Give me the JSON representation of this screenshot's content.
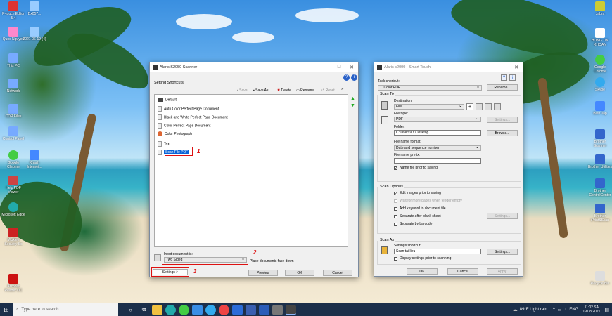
{
  "desktop": {
    "icons_left": [
      {
        "label": "P-touch Editor 5.4",
        "color": "#d33"
      },
      {
        "label": "Dx057...",
        "color": "#9cf"
      },
      {
        "label": "Quoc Nguyen",
        "color": "#f8c"
      },
      {
        "label": "2021-06-19 (4)",
        "color": "#9cf"
      },
      {
        "label": "This PC",
        "color": "#7af"
      },
      {
        "label": "Network",
        "color": "#7af"
      },
      {
        "label": "CDR Files",
        "color": "#7af"
      },
      {
        "label": "Control Panel",
        "color": "#7af"
      },
      {
        "label": "Google Chrome",
        "color": "#4c4"
      },
      {
        "label": "Khach Internet...",
        "color": "#48f"
      },
      {
        "label": "Help PDF Viewer",
        "color": "#c44"
      },
      {
        "label": "Microsoft Edge",
        "color": "#2aa"
      },
      {
        "label": "McAfee Security Sc",
        "color": "#c22"
      },
      {
        "label": "Acrobat Reader DC",
        "color": "#c11"
      }
    ],
    "icons_right": [
      {
        "label": "Jabra",
        "color": "#cc3"
      },
      {
        "label": "HONG TIN KHOAN",
        "color": "#fff"
      },
      {
        "label": "Google Chrome",
        "color": "#4c4"
      },
      {
        "label": "Skype",
        "color": "#3ae"
      },
      {
        "label": "Bien Tap",
        "color": "#48f"
      },
      {
        "label": "Brother Scanner",
        "color": "#36c"
      },
      {
        "label": "Brother Utilities",
        "color": "#36c"
      },
      {
        "label": "Brother ControlCenter",
        "color": "#36c"
      },
      {
        "label": "Brother iPrint&Scan",
        "color": "#36c"
      },
      {
        "label": "Recycle Bin",
        "color": "#ddd"
      }
    ]
  },
  "scanner_window": {
    "title": "Alaris S2050 Scanner",
    "section": "Setting Shortcuts:",
    "toolbar": {
      "save": "Save",
      "save_as": "Save As...",
      "delete": "Delete",
      "rename": "Rename...",
      "reset": "Reset"
    },
    "shortcuts": [
      "Default",
      "Auto Color Perfect Page Document",
      "Black and White Perfect Page Document",
      "Color Perfect Page Document",
      "Color Photograph",
      "Text",
      "Scan File PDF"
    ],
    "input_label": "Input document is:",
    "input_value": "Two Sided",
    "place_text": "Place documents face down",
    "buttons": {
      "settings": "Settings >",
      "preview": "Preview",
      "ok": "OK",
      "cancel": "Cancel"
    },
    "annotations": [
      "1",
      "2",
      "3"
    ]
  },
  "smart_window": {
    "title": "Alaris s2000 - Smart Touch",
    "task_label": "Task shortcut:",
    "task_value": "1. Color PDF",
    "rename": "Rename...",
    "scan_to": "Scan To",
    "destination_label": "Destination:",
    "destination_value": "File",
    "file_type_label": "File type:",
    "file_type_value": "PDF",
    "settings": "Settings...",
    "folder_label": "Folder:",
    "folder_value": "C:\\Users\\LY\\Desktop",
    "browse": "Browse...",
    "name_format_label": "File name format:",
    "name_format_value": "Date and sequence number",
    "prefix_label": "File name prefix:",
    "prefix_value": "",
    "name_prior": "Name file prior to saving",
    "scan_options": "Scan Options",
    "options": [
      {
        "label": "Edit images prior to saving",
        "checked": true,
        "enabled": true
      },
      {
        "label": "Wait for more pages when feeder empty",
        "checked": false,
        "enabled": false
      },
      {
        "label": "Add keyword to document file",
        "checked": false,
        "enabled": true
      },
      {
        "label": "Separate after blank sheet",
        "checked": false,
        "enabled": true
      },
      {
        "label": "Separate by barcode",
        "checked": false,
        "enabled": true
      }
    ],
    "options_settings": "Settings...",
    "scan_as": "Scan As",
    "settings_shortcut_label": "Settings shortcut:",
    "settings_shortcut_value": "Scan tai lieu",
    "shortcut_settings": "Settings...",
    "display_settings": "Display settings prior to scanning",
    "buttons": {
      "ok": "OK",
      "cancel": "Cancel",
      "apply": "Apply"
    }
  },
  "taskbar": {
    "search_placeholder": "Type here to search",
    "weather": "89°F  Light rain",
    "lang": "ENG",
    "time": "11:02 SA",
    "date": "19/08/2021"
  }
}
